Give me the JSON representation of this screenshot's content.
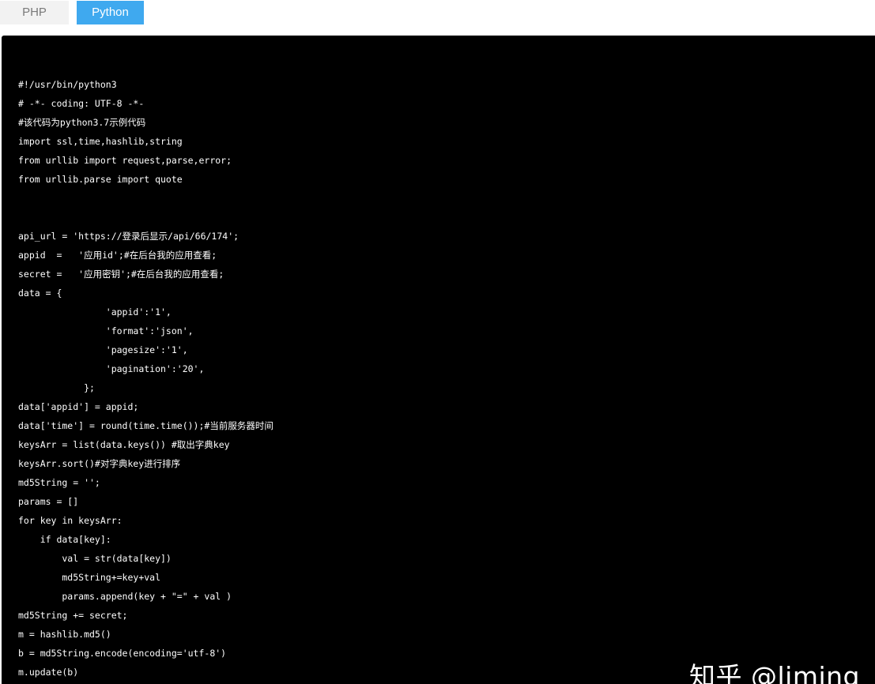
{
  "tabs": [
    {
      "label": "PHP",
      "active": false
    },
    {
      "label": "Python",
      "active": true
    }
  ],
  "colors": {
    "active_tab": "#3fa9ef",
    "inactive_tab": "#f2f2f2",
    "code_background": "#000000",
    "code_text": "#ffffff"
  },
  "code": {
    "lines": [
      "#!/usr/bin/python3",
      "# -*- coding: UTF-8 -*-",
      "#该代码为python3.7示例代码",
      "import ssl,time,hashlib,string",
      "from urllib import request,parse,error;",
      "from urllib.parse import quote",
      "",
      "",
      "api_url = 'https://登录后显示/api/66/174';",
      "appid  =   '应用id';#在后台我的应用查看;",
      "secret =   '应用密钥';#在后台我的应用查看;",
      "data = {",
      "                'appid':'1',",
      "                'format':'json',",
      "                'pagesize':'1',",
      "                'pagination':'20',",
      "            };",
      "data['appid'] = appid;",
      "data['time'] = round(time.time());#当前服务器时间",
      "keysArr = list(data.keys()) #取出字典key",
      "keysArr.sort()#对字典key进行排序",
      "md5String = '';",
      "params = []",
      "for key in keysArr:",
      "    if data[key]:",
      "        val = str(data[key])",
      "        md5String+=key+val",
      "        params.append(key + \"=\" + val )",
      "md5String += secret;",
      "m = hashlib.md5()",
      "b = md5String.encode(encoding='utf-8')",
      "m.update(b)"
    ]
  },
  "watermark": {
    "text": "知乎 @liming"
  }
}
